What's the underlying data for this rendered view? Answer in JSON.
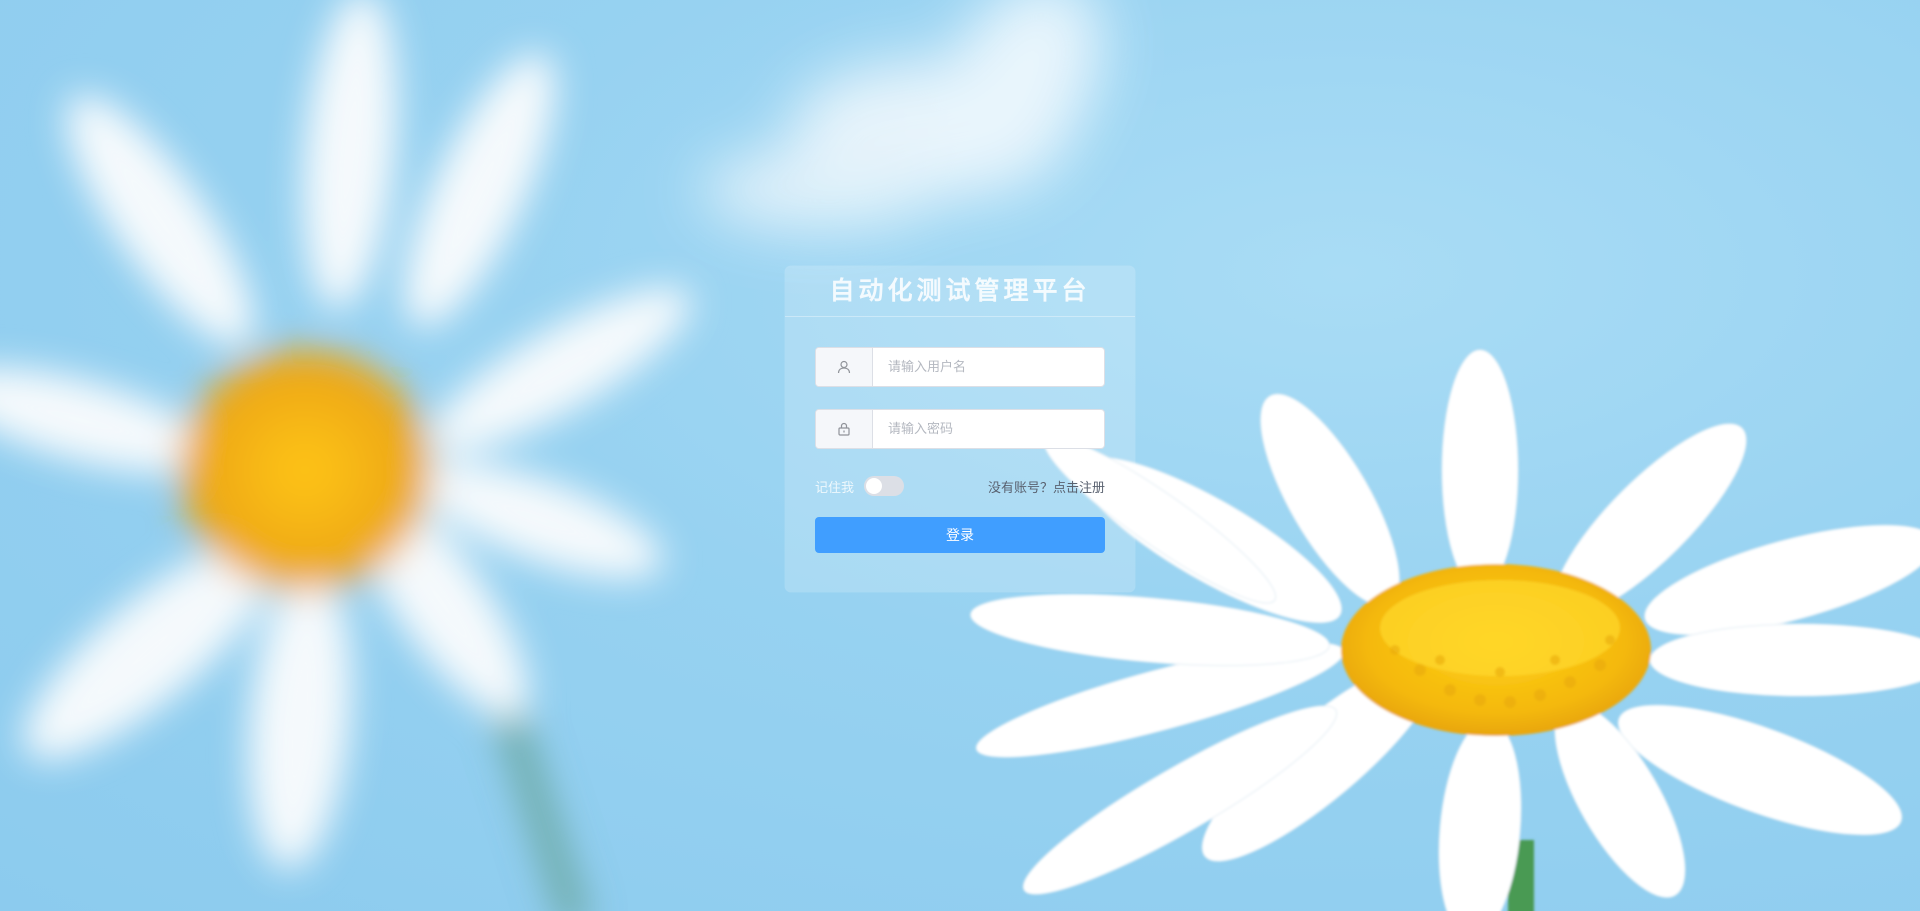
{
  "app": {
    "title": "自动化测试管理平台"
  },
  "login": {
    "username_placeholder": "请输入用户名",
    "username_value": "",
    "password_placeholder": "请输入密码",
    "password_value": "",
    "remember_label": "记住我",
    "remember_on": false,
    "register_text": "没有账号？点击注册",
    "submit_label": "登录"
  },
  "icons": {
    "username": "user-icon",
    "password": "lock-icon"
  },
  "colors": {
    "primary": "#409eff",
    "background": "#97d2f1",
    "switch_off": "#dcdfe6"
  }
}
